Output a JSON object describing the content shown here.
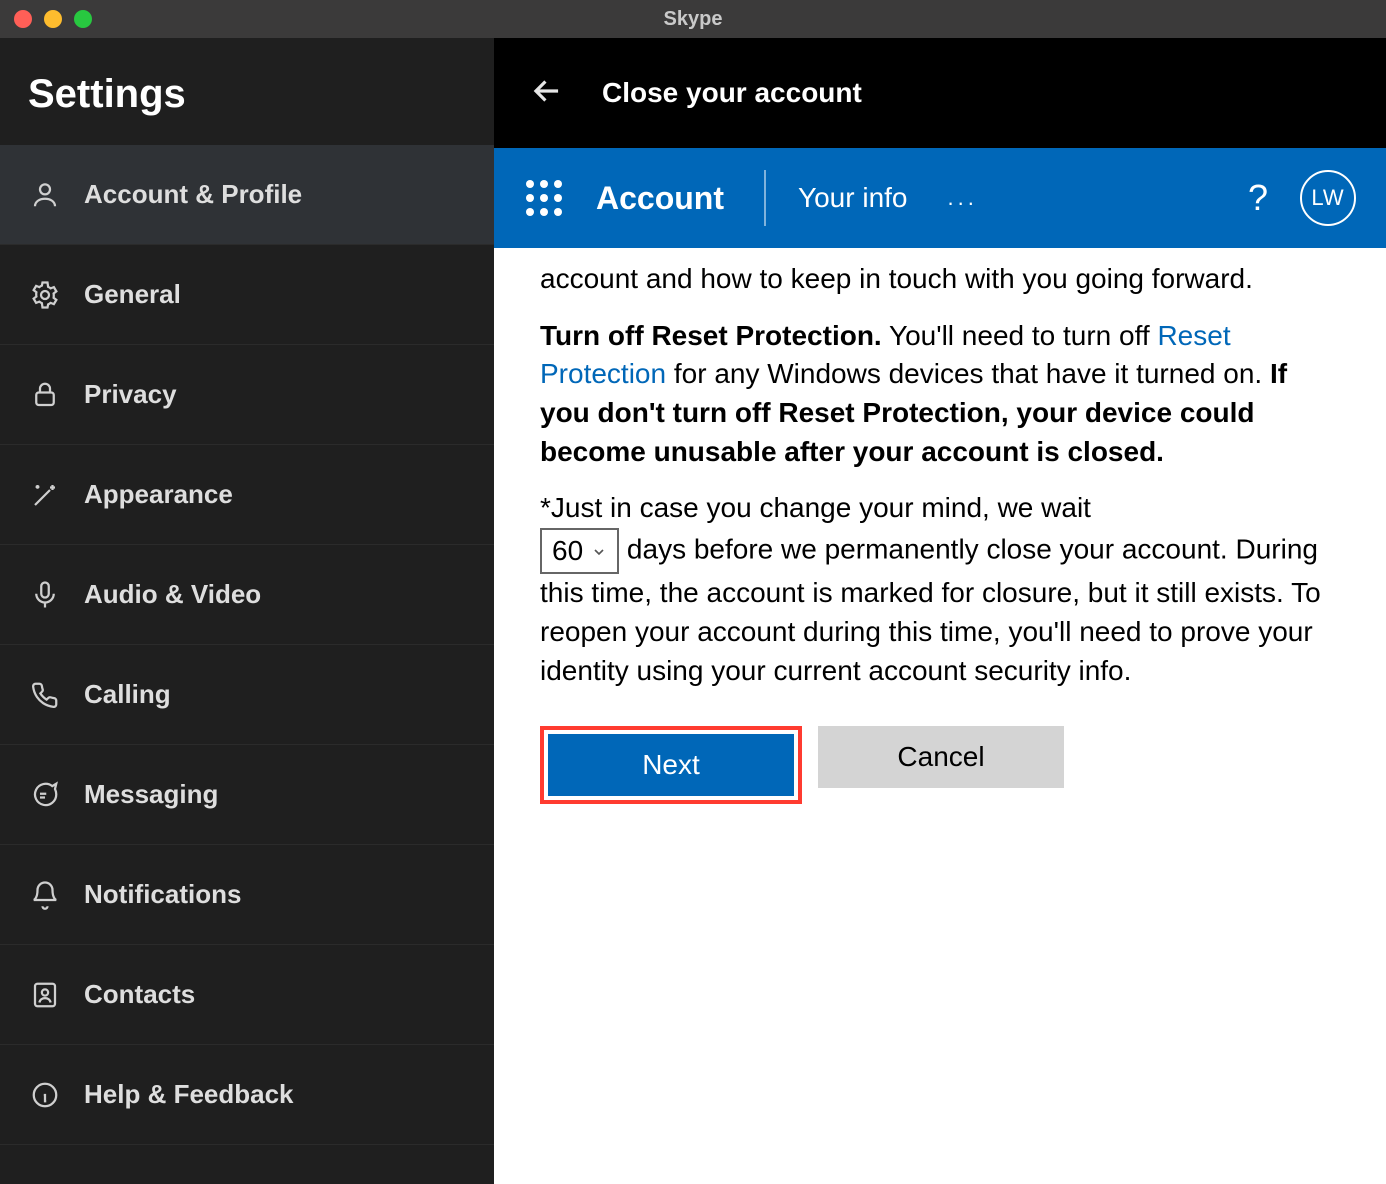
{
  "window": {
    "title": "Skype"
  },
  "sidebar": {
    "title": "Settings",
    "items": [
      {
        "label": "Account & Profile"
      },
      {
        "label": "General"
      },
      {
        "label": "Privacy"
      },
      {
        "label": "Appearance"
      },
      {
        "label": "Audio & Video"
      },
      {
        "label": "Calling"
      },
      {
        "label": "Messaging"
      },
      {
        "label": "Notifications"
      },
      {
        "label": "Contacts"
      },
      {
        "label": "Help & Feedback"
      }
    ]
  },
  "content": {
    "header_title": "Close your account",
    "ms_bar": {
      "account": "Account",
      "your_info": "Your info",
      "ellipsis": "...",
      "help_glyph": "?",
      "avatar_initials": "LW"
    },
    "body": {
      "p1": "account and how to keep in touch with you going forward.",
      "rp": {
        "lead_bold": "Turn off Reset Protection.",
        "after_lead": " You'll need to turn off ",
        "link": "Reset Protection",
        "after_link": " for any Windows devices that have it turned on. ",
        "warn_bold": "If you don't turn off Reset Protection, your device could become unusable after your account is closed."
      },
      "wait": {
        "before": "*Just in case you change your mind, we wait ",
        "days_value": "60",
        "after_select": " days before we permanently close your account. During this time, the account is marked for closure, but it still exists. To reopen your account during this time, you'll need to prove your identity using your current account security info."
      },
      "buttons": {
        "next": "Next",
        "cancel": "Cancel"
      }
    }
  }
}
